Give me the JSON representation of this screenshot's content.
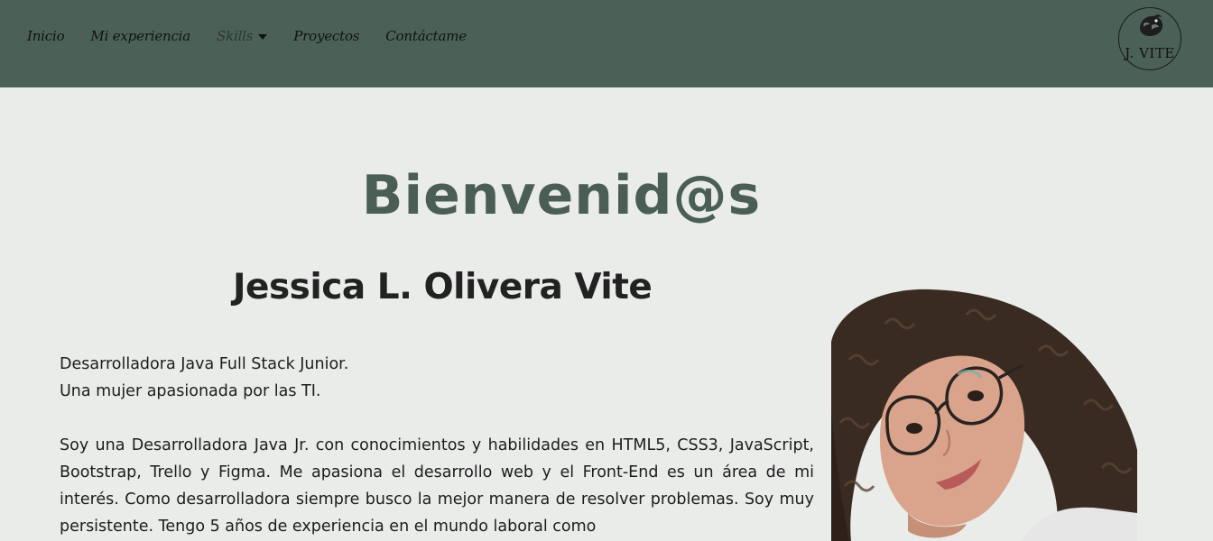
{
  "nav": {
    "items": [
      {
        "label": "Inicio"
      },
      {
        "label": "Mi experiencia"
      },
      {
        "label": "Skills"
      },
      {
        "label": "Proyectos"
      },
      {
        "label": "Contáctame"
      }
    ]
  },
  "logo": {
    "text": "J. VITE"
  },
  "hero": {
    "welcome": "Bienvenid@s",
    "name": "Jessica L. Olivera Vite",
    "tagline_1": "Desarrolladora Java Full Stack Junior.",
    "tagline_2": "Una mujer apasionada por las TI.",
    "bio": "Soy una Desarrolladora Java Jr. con conocimientos y habilidades en HTML5, CSS3, JavaScript, Bootstrap, Trello y Figma. Me apasiona el desarrollo web y el Front-End es un área de mi interés. Como desarrolladora siempre busco la mejor manera de resolver problemas. Soy muy persistente. Tengo 5 años de experiencia en el mundo laboral como"
  },
  "colors": {
    "navbar": "#4b6158",
    "page_background": "#eaecea",
    "welcome_text": "#4a5e55"
  },
  "icons": [
    "chevron-down-icon",
    "logo-bird-icon"
  ]
}
